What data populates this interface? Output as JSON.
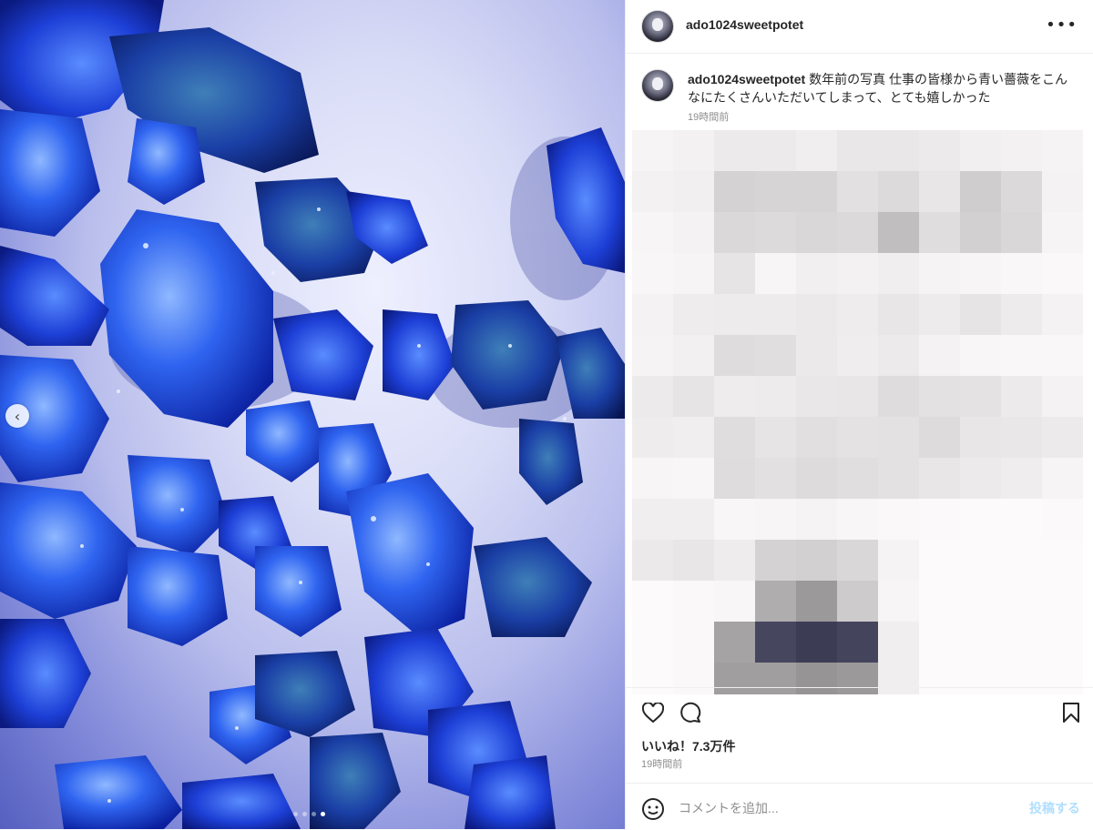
{
  "post": {
    "username": "ado1024sweetpotet",
    "more_icon": "more-options-icon"
  },
  "caption": {
    "username": "ado1024sweetpotet",
    "text": "数年前の写真 仕事の皆様から青い薔薇をこんなにたくさんいただいてしまって、とても嬉しかった",
    "time": "19時間前"
  },
  "image": {
    "description": "blue-rose-petals",
    "carousel_count": 4,
    "carousel_active": 4,
    "prev_icon": "chevron-left-icon"
  },
  "actions": {
    "like_icon": "heart-icon",
    "comment_icon": "comment-bubble-icon",
    "save_icon": "bookmark-icon"
  },
  "likes": "いいね！7.3万件",
  "post_time": "19時間前",
  "comment": {
    "emoji_icon": "emoji-icon",
    "placeholder": "コメントを追加...",
    "post_label": "投稿する"
  },
  "colors": {
    "link_disabled": "#b2dffc",
    "muted_text": "#8e8e8e",
    "petal_blue": "#1f4ee8"
  }
}
